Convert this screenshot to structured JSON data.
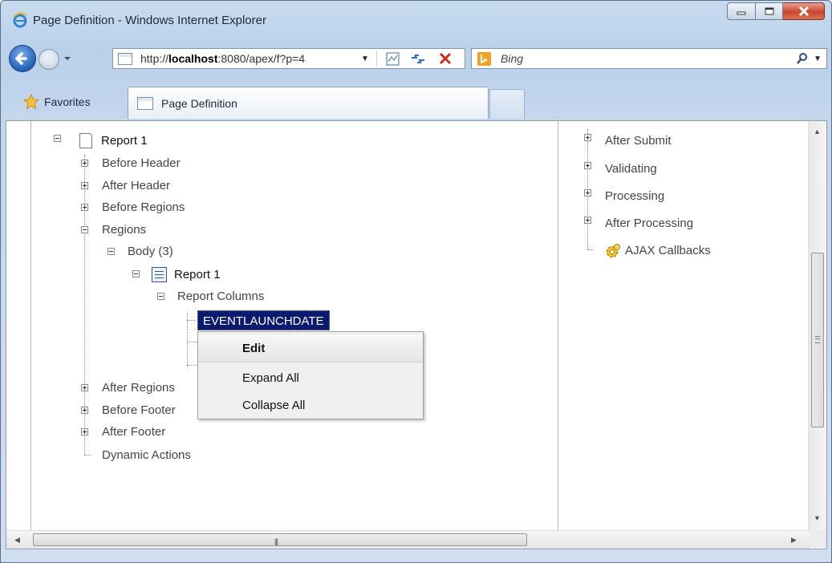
{
  "window": {
    "title": "Page Definition - Windows Internet Explorer"
  },
  "address_bar": {
    "url_prefix": "http://",
    "url_host": "localhost",
    "url_rest": ":8080/apex/f?p=4"
  },
  "search_bar": {
    "placeholder": "Bing"
  },
  "favorites_bar": {
    "favorites_label": "Favorites",
    "active_tab_label": "Page Definition"
  },
  "left_tree": {
    "report_page": "Report 1",
    "before_header": "Before Header",
    "after_header": "After Header",
    "before_regions": "Before Regions",
    "regions": "Regions",
    "body": "Body (3)",
    "report_region": "Report 1",
    "report_columns": "Report Columns",
    "selected_column": "EVENTLAUNCHDATE",
    "after_regions": "After Regions",
    "before_footer": "Before Footer",
    "after_footer": "After Footer",
    "dynamic_actions": "Dynamic Actions"
  },
  "context_menu": {
    "edit": "Edit",
    "expand_all": "Expand All",
    "collapse_all": "Collapse All"
  },
  "right_tree": {
    "after_submit": "After Submit",
    "validating": "Validating",
    "processing": "Processing",
    "after_processing": "After Processing",
    "ajax_callbacks": "AJAX Callbacks"
  },
  "colors": {
    "selection": "#0a1a6e",
    "close_button": "#c9462c"
  }
}
